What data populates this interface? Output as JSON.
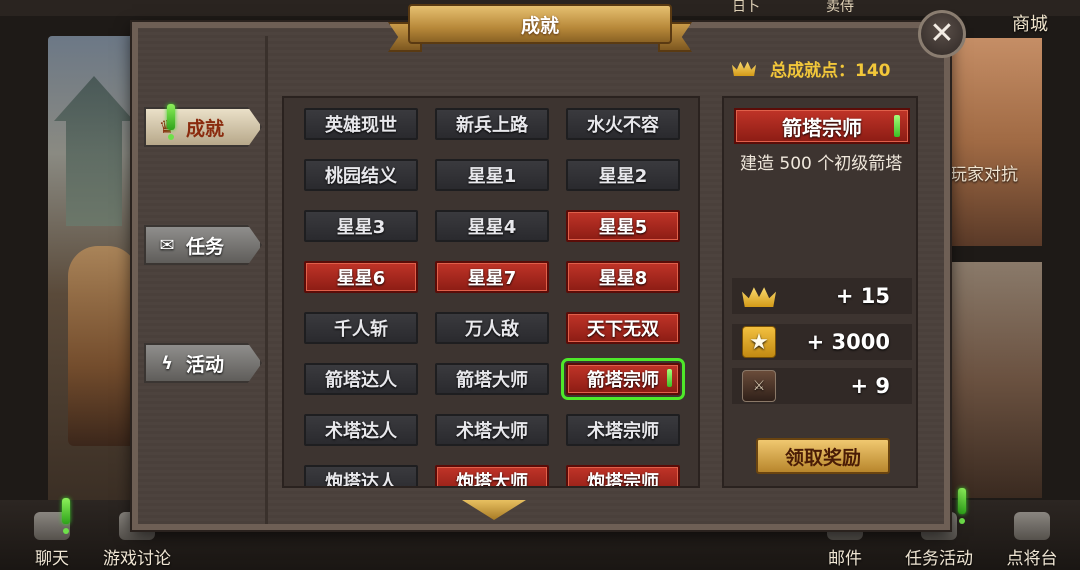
{
  "background": {
    "pvp_label": "玩家对抗",
    "shop_label": "商城",
    "top_items": [
      "日卜",
      "卖侍"
    ]
  },
  "bottom_bar": {
    "items": [
      {
        "label": "聊天",
        "icon": "chat-icon"
      },
      {
        "label": "游戏讨论",
        "icon": "users-icon"
      },
      {
        "label": "邮件",
        "icon": "mail-icon"
      },
      {
        "label": "任务活动",
        "icon": "task-icon"
      },
      {
        "label": "点将台",
        "icon": "general-icon"
      }
    ]
  },
  "dialog": {
    "title": "成就",
    "total_points_label": "总成就点：",
    "total_points_value": "140",
    "close_icon": "close-icon"
  },
  "nav_tabs": [
    {
      "label": "成就",
      "icon": "crown-icon",
      "active": true,
      "alert": true
    },
    {
      "label": "任务",
      "icon": "scroll-icon",
      "active": false,
      "alert": false
    },
    {
      "label": "活动",
      "icon": "lightning-icon",
      "active": false,
      "alert": false
    }
  ],
  "achievements": [
    {
      "label": "英雄现世",
      "completed": false
    },
    {
      "label": "新兵上路",
      "completed": false
    },
    {
      "label": "水火不容",
      "completed": false
    },
    {
      "label": "桃园结义",
      "completed": false
    },
    {
      "label": "星星1",
      "completed": false
    },
    {
      "label": "星星2",
      "completed": false
    },
    {
      "label": "星星3",
      "completed": false
    },
    {
      "label": "星星4",
      "completed": false
    },
    {
      "label": "星星5",
      "completed": true
    },
    {
      "label": "星星6",
      "completed": true
    },
    {
      "label": "星星7",
      "completed": true
    },
    {
      "label": "星星8",
      "completed": true
    },
    {
      "label": "千人斩",
      "completed": false
    },
    {
      "label": "万人敌",
      "completed": false
    },
    {
      "label": "天下无双",
      "completed": true
    },
    {
      "label": "箭塔达人",
      "completed": false
    },
    {
      "label": "箭塔大师",
      "completed": false
    },
    {
      "label": "箭塔宗师",
      "completed": true,
      "selected": true,
      "alert": true
    },
    {
      "label": "术塔达人",
      "completed": false
    },
    {
      "label": "术塔大师",
      "completed": false
    },
    {
      "label": "术塔宗师",
      "completed": false
    },
    {
      "label": "炮塔达人",
      "completed": false
    },
    {
      "label": "炮塔大师",
      "completed": true
    },
    {
      "label": "炮塔宗师",
      "completed": true
    }
  ],
  "detail": {
    "title": "箭塔宗师",
    "description": "建造 500 个初级箭塔",
    "rewards": [
      {
        "icon": "crown-icon",
        "value": "+ 15"
      },
      {
        "icon": "star-icon",
        "value": "+ 3000"
      },
      {
        "icon": "troop-icon",
        "value": "+ 9"
      }
    ],
    "claim_label": "领取奖励"
  },
  "colors": {
    "accent_gold": "#f2c73a",
    "completed_red": "#c03428",
    "selected_green": "#4ee82a",
    "alert_green": "#3cbf24"
  }
}
